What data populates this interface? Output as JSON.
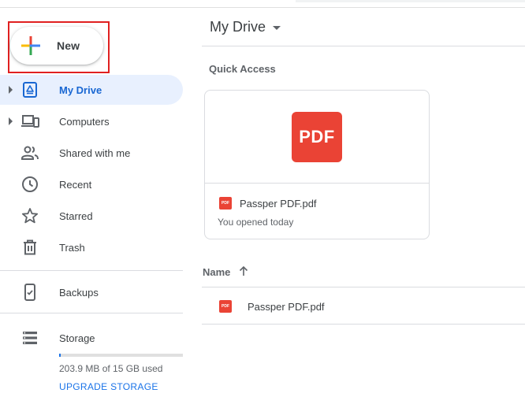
{
  "sidebar": {
    "new_label": "New",
    "items": [
      {
        "label": "My Drive",
        "active": true
      },
      {
        "label": "Computers"
      },
      {
        "label": "Shared with me"
      },
      {
        "label": "Recent"
      },
      {
        "label": "Starred"
      },
      {
        "label": "Trash"
      },
      {
        "label": "Backups"
      },
      {
        "label": "Storage"
      }
    ],
    "storage": {
      "used_text": "203.9 MB of 15 GB used",
      "used_fraction": 0.013,
      "upgrade_label": "UPGRADE STORAGE"
    }
  },
  "main": {
    "title": "My Drive",
    "quick_access": {
      "title": "Quick Access",
      "card": {
        "icon_text": "PDF",
        "file_name": "Passper PDF.pdf",
        "subtitle": "You opened today"
      }
    },
    "list": {
      "column_name": "Name",
      "rows": [
        {
          "name": "Passper PDF.pdf",
          "icon_text": "PDF"
        }
      ]
    }
  },
  "colors": {
    "accent": "#1a73e8",
    "active_bg": "#e8f0fe",
    "pdf_red": "#ea4335",
    "highlight_box": "#e02020"
  }
}
